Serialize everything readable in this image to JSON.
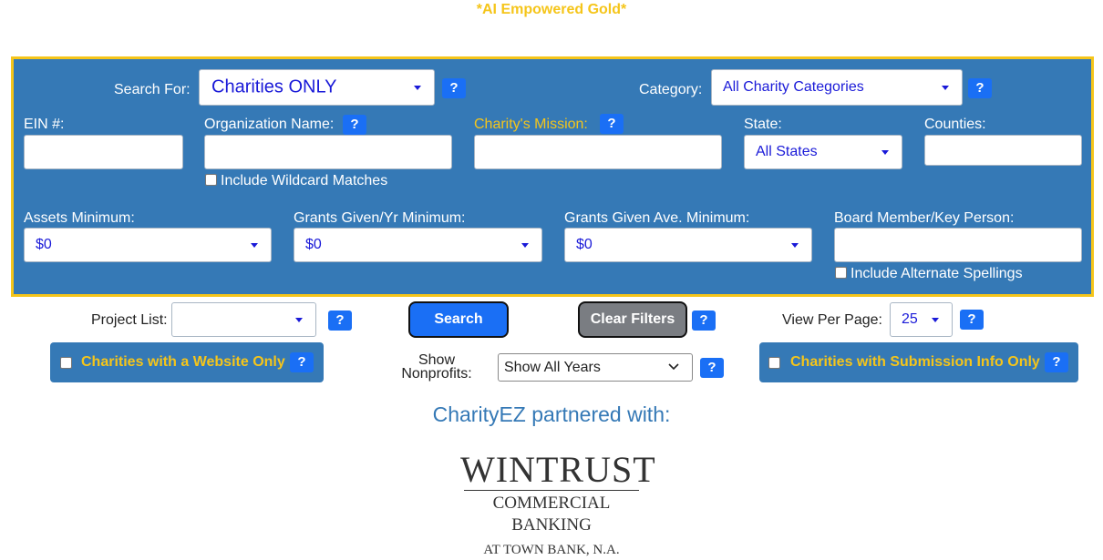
{
  "header": {
    "tagline": "*AI Empowered Gold*"
  },
  "search_for": {
    "label": "Search For:",
    "value": "Charities ONLY"
  },
  "category": {
    "label": "Category:",
    "value": "All Charity Categories"
  },
  "ein": {
    "label": "EIN #:"
  },
  "org_name": {
    "label": "Organization Name:",
    "wildcard_label": "Include Wildcard Matches"
  },
  "mission": {
    "label": "Charity's Mission:"
  },
  "state": {
    "label": "State:",
    "value": "All States"
  },
  "counties": {
    "label": "Counties:"
  },
  "assets_min": {
    "label": "Assets Minimum:",
    "value": "$0"
  },
  "grants_yr_min": {
    "label": "Grants Given/Yr Minimum:",
    "value": "$0"
  },
  "grants_ave_min": {
    "label": "Grants Given Ave. Minimum:",
    "value": "$0"
  },
  "board_member": {
    "label": "Board Member/Key Person:",
    "alt_spellings_label": "Include Alternate Spellings"
  },
  "help_glyph": "?",
  "project_list": {
    "label": "Project List:",
    "value": ""
  },
  "buttons": {
    "search": "Search",
    "clear_filters": "Clear Filters"
  },
  "view_per_page": {
    "label": "View Per Page:",
    "value": "25"
  },
  "website_only": {
    "label": "Charities with a Website Only"
  },
  "show_nonprofits": {
    "label_line1": "Show",
    "label_line2": "Nonprofits:",
    "value": "Show All Years"
  },
  "submission_only": {
    "label": "Charities with Submission Info Only"
  },
  "partner": {
    "heading": "CharityEZ partnered with:"
  },
  "logo": {
    "line1": "WINTRUST",
    "line2": "COMMERCIAL BANKING",
    "line3": "AT TOWN BANK, N.A."
  },
  "colors": {
    "panel": "#3579b6",
    "gold": "#f5c51a",
    "help": "#1a6ff5",
    "select_text": "#1a1ad8"
  }
}
